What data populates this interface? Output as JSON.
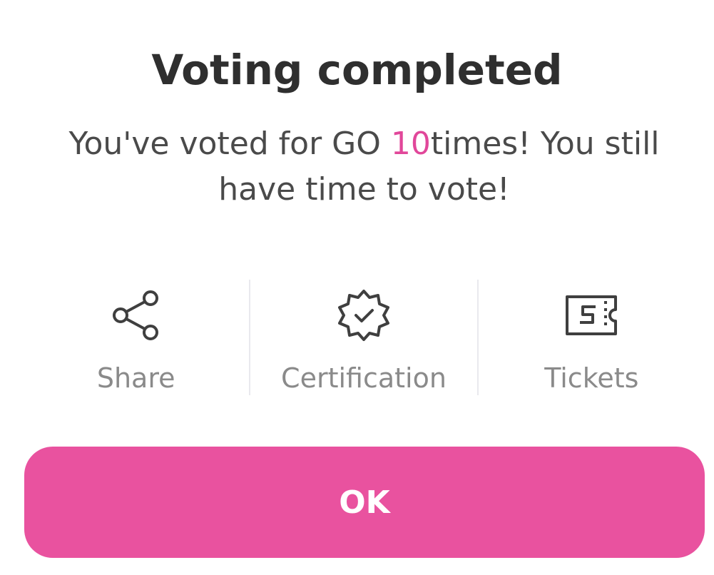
{
  "dialog": {
    "title": "Voting completed",
    "message_prefix": "You've voted for GO ",
    "vote_count": "10",
    "message_suffix": "times! You still have time to vote!",
    "accent_color": "#e1479a"
  },
  "actions": [
    {
      "label": "Share",
      "icon": "share-icon"
    },
    {
      "label": "Certification",
      "icon": "certificate-badge-icon"
    },
    {
      "label": "Tickets",
      "icon": "ticket-icon"
    }
  ],
  "ok_button": {
    "label": "OK",
    "color": "#e9529f"
  }
}
